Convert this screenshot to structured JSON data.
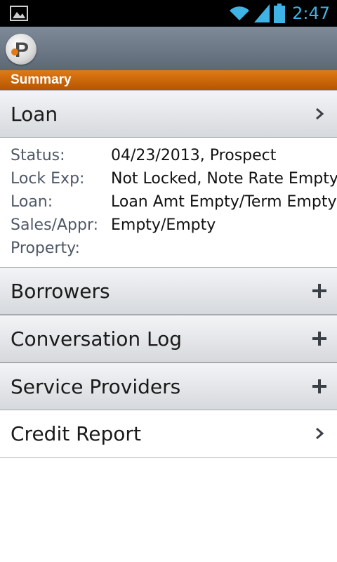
{
  "status_bar": {
    "time": "2:47",
    "icons": [
      "image-icon",
      "wifi-icon",
      "signal-icon",
      "battery-icon"
    ],
    "accent": "#3fb3e6"
  },
  "app_bar": {
    "logo": "P"
  },
  "section_header": {
    "title": "Summary",
    "color": "#c9650a"
  },
  "loan_row": {
    "label": "Loan",
    "icon": "chevron-right-icon"
  },
  "details": [
    {
      "key": "Status:",
      "value": "04/23/2013, Prospect"
    },
    {
      "key": "Lock Exp:",
      "value": "Not Locked, Note Rate Empty"
    },
    {
      "key": "Loan:",
      "value": "Loan Amt Empty/Term Empty"
    },
    {
      "key": "Sales/Appr:",
      "value": "Empty/Empty"
    },
    {
      "key": "Property:",
      "value": ""
    }
  ],
  "sections": [
    {
      "label": "Borrowers",
      "icon": "plus-icon"
    },
    {
      "label": "Conversation Log",
      "icon": "plus-icon"
    },
    {
      "label": "Service Providers",
      "icon": "plus-icon"
    },
    {
      "label": "Credit Report",
      "icon": "chevron-right-icon"
    }
  ]
}
